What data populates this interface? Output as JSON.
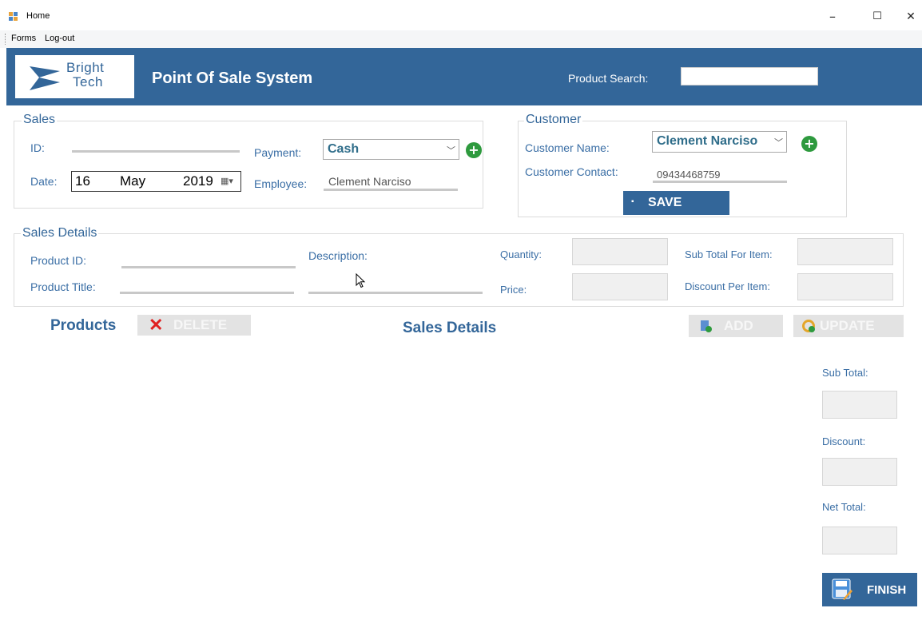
{
  "window": {
    "title": "Home",
    "minimize": "–",
    "maximize": "☐",
    "close": "✕"
  },
  "menu": {
    "items": [
      "Forms",
      "Log-out"
    ]
  },
  "header": {
    "logo_line1": "Bright",
    "logo_line2": "Tech",
    "app_title": "Point Of Sale System",
    "search_label": "Product Search:",
    "search_value": ""
  },
  "sales": {
    "group_title": "Sales",
    "id_label": "ID:",
    "date_label": "Date:",
    "date_day": "16",
    "date_month": "May",
    "date_year": "2019",
    "payment_label": "Payment:",
    "payment_value": "Cash",
    "employee_label": "Employee:",
    "employee_value": "Clement Narciso"
  },
  "customer": {
    "group_title": "Customer",
    "name_label": "Customer Name:",
    "name_value": "Clement Narciso",
    "contact_label": "Customer Contact:",
    "contact_value": "09434468759",
    "save_label": "SAVE"
  },
  "sales_details": {
    "group_title": "Sales Details",
    "product_id_label": "Product ID:",
    "product_title_label": "Product Title:",
    "description_label": "Description:",
    "quantity_label": "Quantity:",
    "price_label": "Price:",
    "subtotal_item_label": "Sub Total For Item:",
    "discount_item_label": "Discount Per Item:"
  },
  "products": {
    "title": "Products",
    "delete_label": "DELETE",
    "details_title": "Sales Details",
    "add_label": "ADD",
    "update_label": "UPDATE"
  },
  "totals": {
    "subtotal_label": "Sub Total:",
    "discount_label": "Discount:",
    "net_total_label": "Net Total:",
    "finish_label": "FINISH"
  },
  "colors": {
    "brand": "#336699",
    "accent_green": "#2e9a3e",
    "delete_red": "#e02020"
  }
}
